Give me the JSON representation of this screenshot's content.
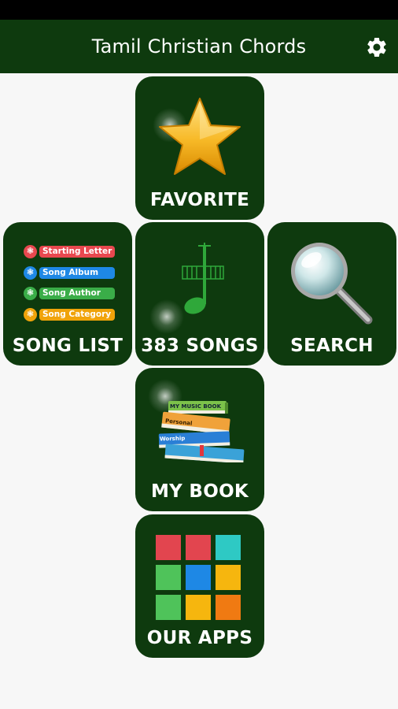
{
  "app_bar": {
    "title": "Tamil Christian Chords",
    "settings_icon": "gear-icon"
  },
  "tiles": {
    "favorite": {
      "label": "FAVORITE",
      "icon": "star-icon"
    },
    "song_list": {
      "label": "SONG LIST",
      "icon": "list-icon",
      "items": [
        {
          "text": "Starting Letter",
          "color": "#e8484f"
        },
        {
          "text": "Song Album",
          "color": "#1e88e5"
        },
        {
          "text": "Song Author",
          "color": "#3aad48"
        },
        {
          "text": "Song Category",
          "color": "#f0a30a"
        }
      ]
    },
    "songs": {
      "label": "383 SONGS",
      "icon": "music-note-icon"
    },
    "search": {
      "label": "SEARCH",
      "icon": "magnifier-icon"
    },
    "my_book": {
      "label": "MY BOOK",
      "icon": "books-icon",
      "book_titles": [
        "MY MUSIC BOOK",
        "Personal",
        "Worship"
      ]
    },
    "our_apps": {
      "label": "OUR APPS",
      "icon": "apps-grid-icon",
      "colors": [
        "#e2454f",
        "#e2454f",
        "#2ec9c4",
        "#4fc35a",
        "#1e88e5",
        "#f6b60e",
        "#4fc35a",
        "#f6b60e",
        "#f07a12"
      ]
    }
  },
  "colors": {
    "status_bar": "#000000",
    "app_bar": "#0e3a0e",
    "tile": "#0e3a0e",
    "background": "#f7f7f7"
  }
}
